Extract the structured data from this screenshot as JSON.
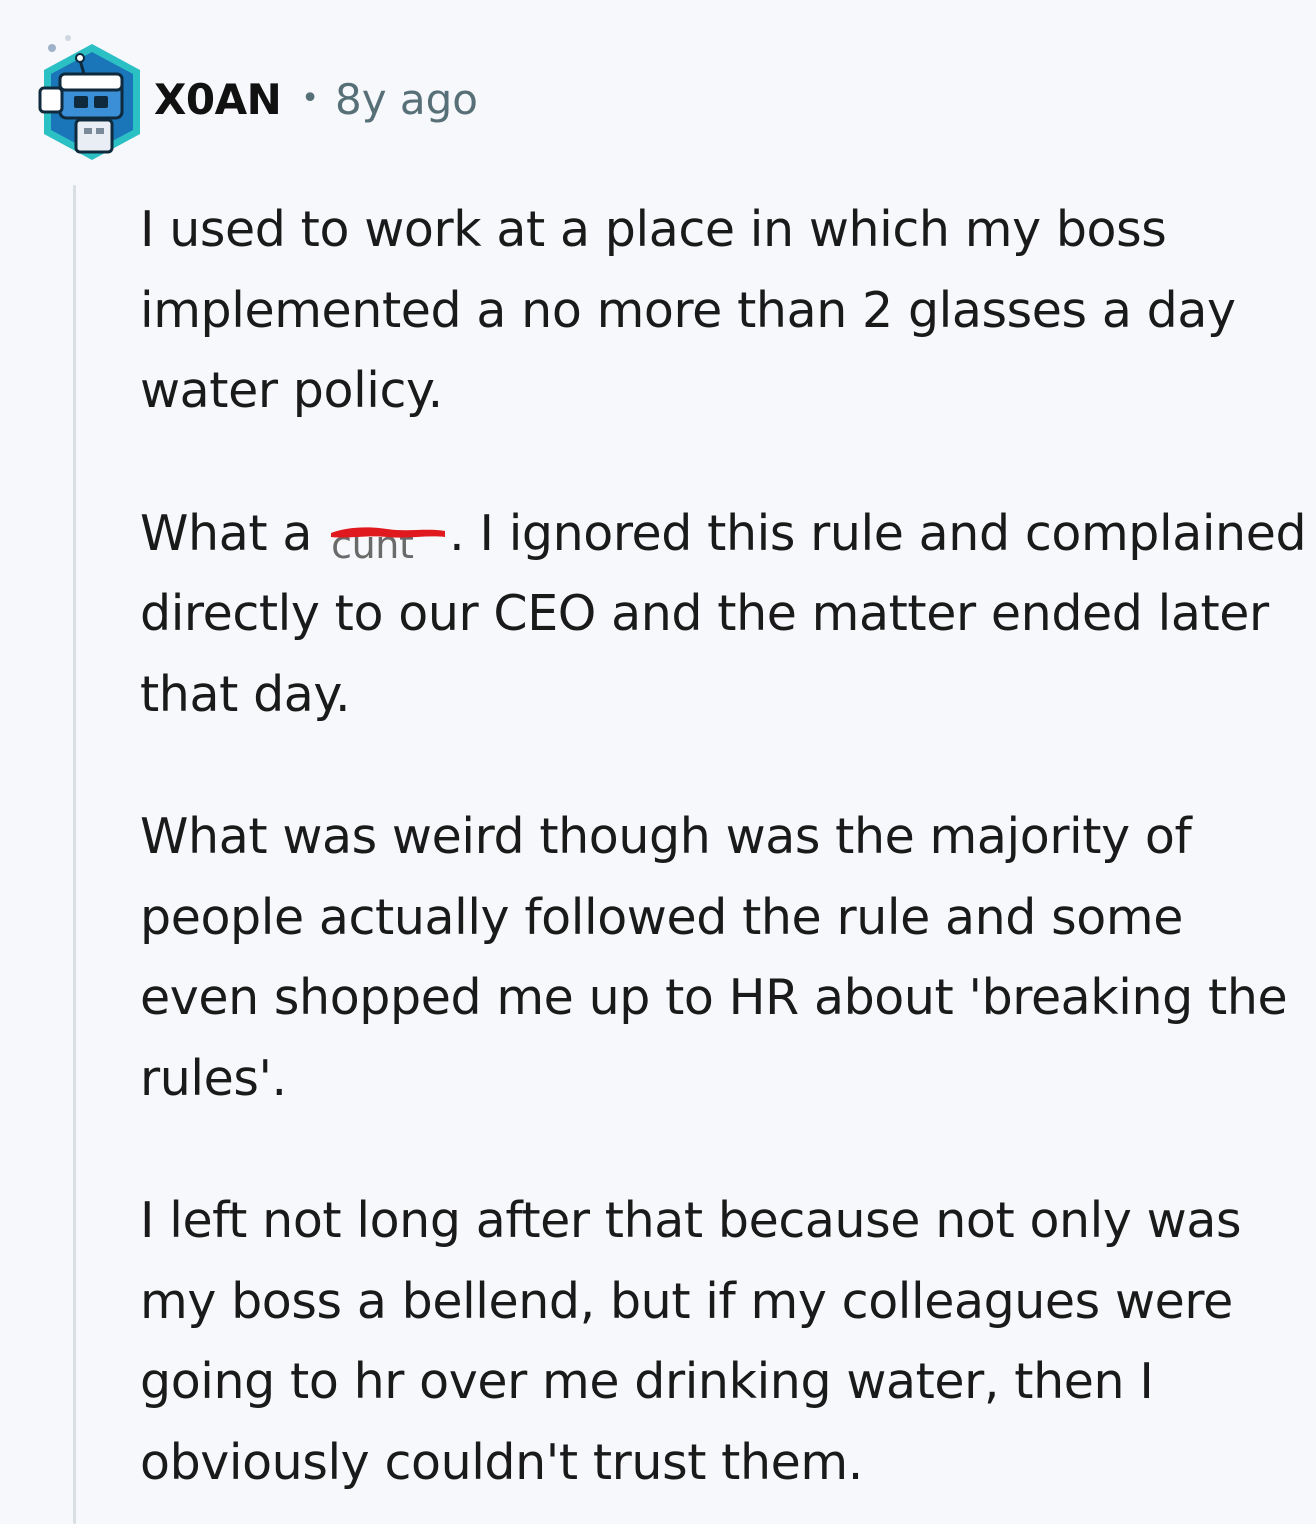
{
  "comment": {
    "username": "X0AN",
    "separator": "•",
    "timestamp": "8y ago",
    "avatar_icon": "snoo-robot-hexagon-icon",
    "paragraphs": {
      "p1": "I used to work at a place in which my boss implemented a no more than 2 glasses a day water policy.",
      "p2_before": "What a ",
      "p2_redacted": "cunt",
      "p2_after": ". I ignored this rule and complained directly to our CEO and the matter ended later that day.",
      "p3": "What was weird though was the majority of people actually followed the rule and some even shopped me up to HR about 'breaking the rules'.",
      "p4": "I left not long after that because not only was my boss a bellend, but if my colleagues were going to hr over me drinking water, then I obviously couldn't trust them."
    }
  },
  "colors": {
    "background": "#f6f8fb",
    "thread_line": "#d7dfe3",
    "redaction": "#e0191f",
    "meta_text": "#576f76"
  }
}
